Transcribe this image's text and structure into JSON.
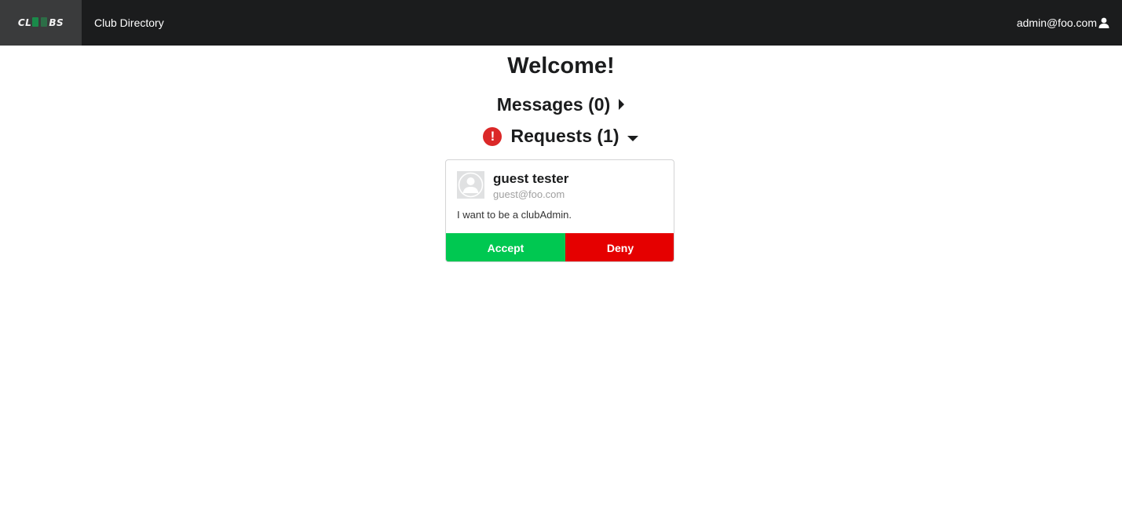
{
  "navbar": {
    "logo_text_left": "CL",
    "logo_text_right": "BS",
    "club_directory": "Club Directory",
    "user_email": "admin@foo.com"
  },
  "page": {
    "title": "Welcome!"
  },
  "messages": {
    "label": "Messages (0)",
    "expanded": false
  },
  "requests": {
    "alert_symbol": "!",
    "label": "Requests (1)",
    "expanded": true,
    "items": [
      {
        "name": "guest tester",
        "email": "guest@foo.com",
        "message": "I want to be a clubAdmin.",
        "accept_label": "Accept",
        "deny_label": "Deny"
      }
    ]
  },
  "colors": {
    "navbar_bg": "#1b1c1d",
    "accept": "#00c851",
    "deny": "#e50000",
    "alert": "#db2828"
  },
  "icons": {
    "user": "user-icon",
    "alert": "exclamation-circle-icon",
    "caret_right": "caret-right-icon",
    "caret_down": "caret-down-icon",
    "avatar": "avatar-placeholder-icon"
  }
}
